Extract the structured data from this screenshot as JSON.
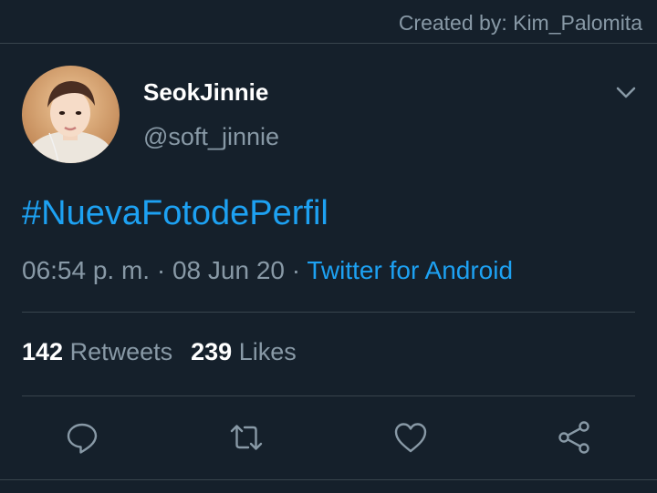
{
  "credit": "Created by: Kim_Palomita",
  "user": {
    "display_name": "SeokJinnie",
    "handle": "@soft_jinnie"
  },
  "tweet": {
    "text": "#NuevaFotodePerfil",
    "time": "06:54 p. m.",
    "separator1": " · ",
    "date": "08 Jun 20",
    "separator2": " · ",
    "source": "Twitter for Android"
  },
  "stats": {
    "retweets_count": "142",
    "retweets_label": "Retweets",
    "likes_count": "239",
    "likes_label": "Likes"
  },
  "icons": {
    "reply": "speech-bubble-icon",
    "retweet": "retweet-arrows-icon",
    "like": "heart-icon",
    "share": "share-nodes-icon",
    "menu": "chevron-down-icon"
  },
  "colors": {
    "background": "#15202b",
    "accent": "#1da1f2",
    "secondary_text": "#8899a6",
    "divider": "#38444d"
  }
}
